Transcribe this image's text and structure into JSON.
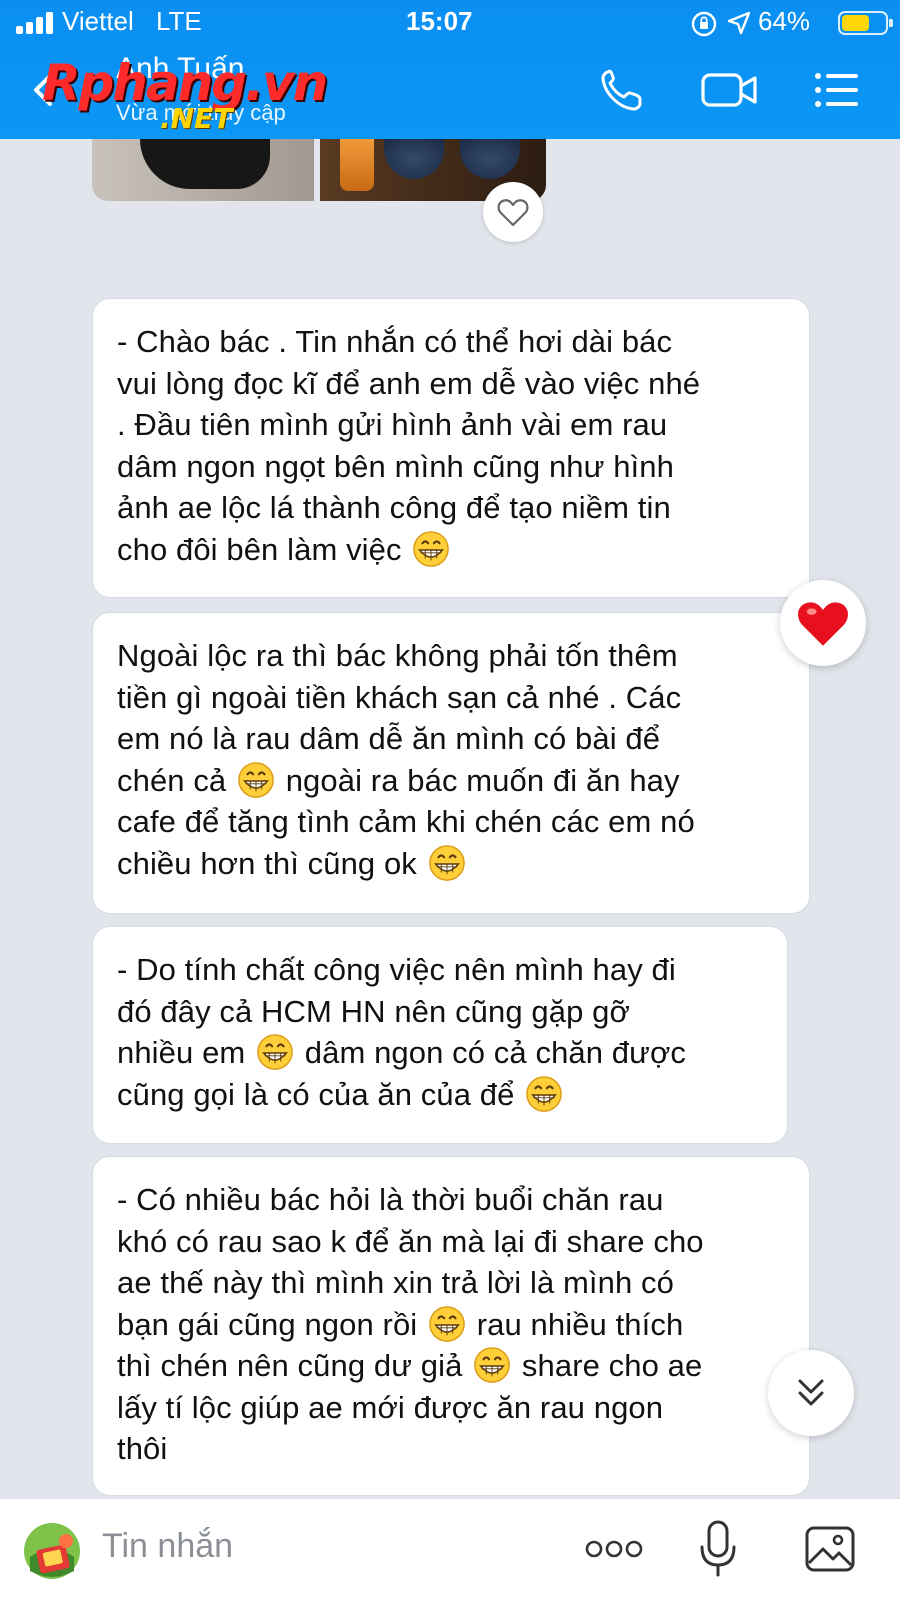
{
  "status_bar": {
    "carrier": "Viettel",
    "network": "LTE",
    "time": "15:07",
    "battery_text": "64%",
    "battery_level": 0.64,
    "icons": [
      "signal-icon",
      "orientation-lock-icon",
      "location-arrow-icon",
      "battery-icon"
    ]
  },
  "header": {
    "contact_name": "Anh Tuấn",
    "contact_status": "Vừa mới truy cập",
    "watermark_text": "Rphang.vn",
    "watermark_subtext": ".NET",
    "icons": [
      "back-chevron-icon",
      "phone-icon",
      "video-call-icon",
      "menu-list-icon"
    ],
    "color": "#0b93f3"
  },
  "messages": [
    {
      "id": "msg1",
      "parts": [
        "- Chào bác . Tin nhắn có thể hơi dài bác",
        "vui lòng đọc kĩ để anh em dễ vào việc nhé",
        ". Đầu tiên mình gửi hình ảnh vài em rau",
        "dâm ngon ngọt bên mình cũng như hình",
        "ảnh ae lộc lá thành công để tạo niềm tin",
        "cho đôi bên làm việc"
      ]
    },
    {
      "id": "msg2",
      "parts": [
        "Ngoài lộc ra thì bác không phải tốn thêm",
        "tiền gì ngoài tiền khách sạn cả nhé . Các",
        "em nó là rau dâm dễ ăn mình có bài để",
        "chén cả",
        "ngoài ra bác muốn đi ăn hay",
        "cafe để tăng tình cảm khi chén các em nó",
        "chiều hơn thì cũng ok"
      ],
      "reaction": "heart-icon"
    },
    {
      "id": "msg3",
      "parts": [
        "- Do tính chất công việc nên mình hay đi",
        "đó đây cả HCM HN nên cũng gặp gỡ",
        "nhiều em",
        "dâm ngon có cả chăn được",
        "cũng gọi là có của ăn của để"
      ]
    },
    {
      "id": "msg4",
      "parts": [
        "- Có nhiều bác hỏi là thời buổi chăn rau",
        "khó có rau sao k để ăn mà lại đi share cho",
        "ae thế này thì mình xin trả lời là mình có",
        "bạn gái cũng ngon rồi",
        "rau nhiều thích",
        "thì chén nên cũng dư giả",
        "share cho ae",
        "lấy tí lộc giúp ae mới được ăn rau ngon",
        "thôi"
      ]
    }
  ],
  "input": {
    "placeholder": "Tin nhắn",
    "icons": [
      "sticker-icon",
      "more-dots-icon",
      "microphone-icon",
      "image-icon"
    ]
  },
  "colors": {
    "header_blue": "#0b93f3",
    "chat_background": "#e2e6ec",
    "reaction_heart": "#e8101f"
  }
}
